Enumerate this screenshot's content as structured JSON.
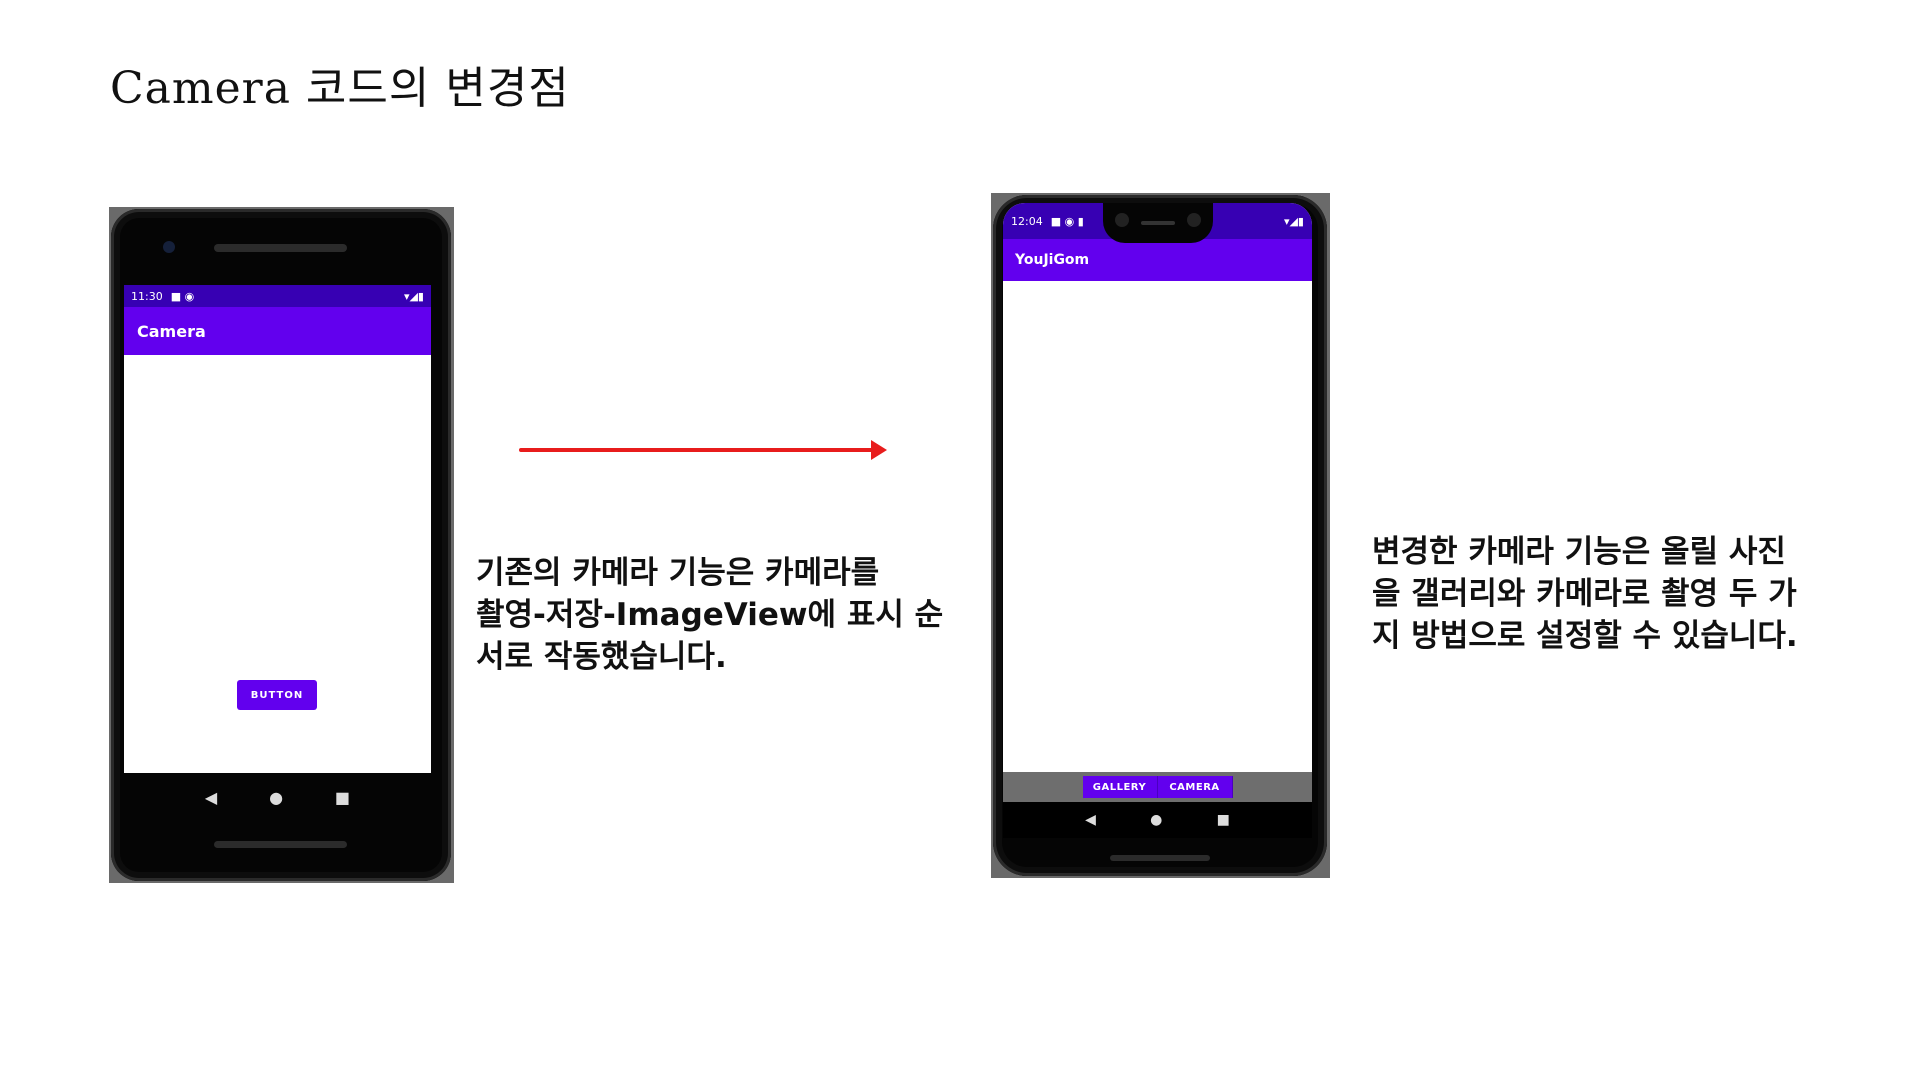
{
  "slide": {
    "title": "Camera 코드의 변경점"
  },
  "phone_before": {
    "status_time": "11:30",
    "app_title": "Camera",
    "button_label": "BUTTON",
    "nav": {
      "back": "◀",
      "home": "●",
      "recent": "■"
    }
  },
  "phone_after": {
    "status_time": "12:04",
    "app_title": "YouJiGom",
    "gallery_label": "GALLERY",
    "camera_label": "CAMERA",
    "nav": {
      "back": "◀",
      "home": "●",
      "recent": "■"
    }
  },
  "arrow": {
    "color": "#e81c1c"
  },
  "descriptions": {
    "before": [
      "기존의 카메라 기능은 카메라를",
      "촬영-저장-ImageView에 표시 순",
      "서로 작동했습니다."
    ],
    "after": [
      "변경한 카메라 기능은 올릴 사진",
      "을 갤러리와 카메라로 촬영 두 가",
      "지 방법으로 설정할 수 있습니다."
    ]
  },
  "colors": {
    "primary": "#6200ee",
    "primary_dark": "#3700b3"
  }
}
